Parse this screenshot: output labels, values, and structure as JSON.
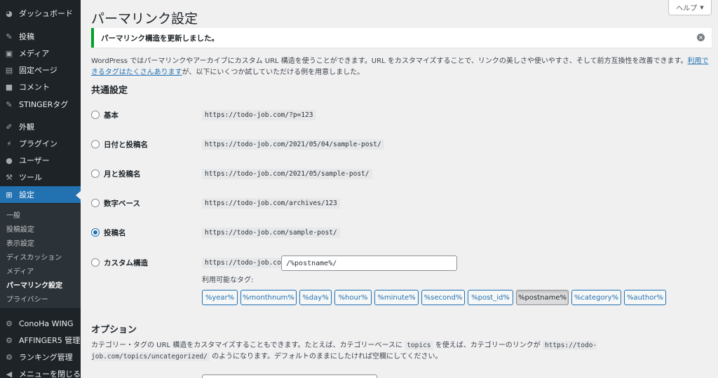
{
  "sidebar": {
    "items": [
      {
        "label": "ダッシュボード",
        "icon": "dashboard-icon"
      },
      {
        "label": "投稿",
        "icon": "pin-icon"
      },
      {
        "label": "メディア",
        "icon": "media-icon"
      },
      {
        "label": "固定ページ",
        "icon": "page-icon"
      },
      {
        "label": "コメント",
        "icon": "comment-icon"
      },
      {
        "label": "STINGERタグ",
        "icon": "pin-icon"
      },
      {
        "label": "外観",
        "icon": "brush-icon"
      },
      {
        "label": "プラグイン",
        "icon": "plugin-icon"
      },
      {
        "label": "ユーザー",
        "icon": "user-icon"
      },
      {
        "label": "ツール",
        "icon": "wrench-icon"
      },
      {
        "label": "設定",
        "icon": "settings-icon"
      },
      {
        "label": "ConoHa WING",
        "icon": "gear-icon"
      },
      {
        "label": "AFFINGER5 管理",
        "icon": "gear-icon"
      },
      {
        "label": "ランキング管理",
        "icon": "gear-icon"
      },
      {
        "label": "メニューを閉じる",
        "icon": "collapse-icon"
      }
    ],
    "submenu": [
      "一般",
      "投稿設定",
      "表示設定",
      "ディスカッション",
      "メディア",
      "パーマリンク設定",
      "プライバシー"
    ]
  },
  "header": {
    "title": "パーマリンク設定",
    "help_label": "ヘルプ"
  },
  "notice": {
    "text": "パーマリンク構造を更新しました。"
  },
  "intro": {
    "text_before": "WordPress ではパーマリンクやアーカイブにカスタム URL 構造を使うことができます。URL をカスタマイズすることで、リンクの美しさや使いやすさ、そして前方互換性を改善できます。",
    "link": "利用できるタグはたくさんあります",
    "text_after": "が、以下にいくつか試していただける例を用意しました。"
  },
  "common": {
    "title": "共通設定",
    "options": [
      {
        "label": "基本",
        "example": "https://todo-job.com/?p=123",
        "checked": false
      },
      {
        "label": "日付と投稿名",
        "example": "https://todo-job.com/2021/05/04/sample-post/",
        "checked": false
      },
      {
        "label": "月と投稿名",
        "example": "https://todo-job.com/2021/05/sample-post/",
        "checked": false
      },
      {
        "label": "数字ベース",
        "example": "https://todo-job.com/archives/123",
        "checked": false
      },
      {
        "label": "投稿名",
        "example": "https://todo-job.com/sample-post/",
        "checked": true
      },
      {
        "label": "カスタム構造",
        "example": "https://todo-job.com",
        "checked": false
      }
    ],
    "custom_value": "/%postname%/",
    "tags_label": "利用可能なタグ:",
    "tags": [
      "%year%",
      "%monthnum%",
      "%day%",
      "%hour%",
      "%minute%",
      "%second%",
      "%post_id%",
      "%postname%",
      "%category%",
      "%author%"
    ],
    "active_tag": "%postname%"
  },
  "options_section": {
    "title": "オプション",
    "desc_1": "カテゴリー・タグの URL 構造をカスタマイズすることもできます。たとえば、カテゴリーベースに",
    "code_1": "topics",
    "desc_2": "を使えば、カテゴリーのリンクが",
    "code_2": "https://todo-job.com/topics/uncategorized/",
    "desc_3": "のようになります。デフォルトのままにしたければ空欄にしてください。"
  },
  "colors": {
    "sidebar_bg": "#1d2327",
    "accent": "#2271b1",
    "success": "#00a32a"
  }
}
